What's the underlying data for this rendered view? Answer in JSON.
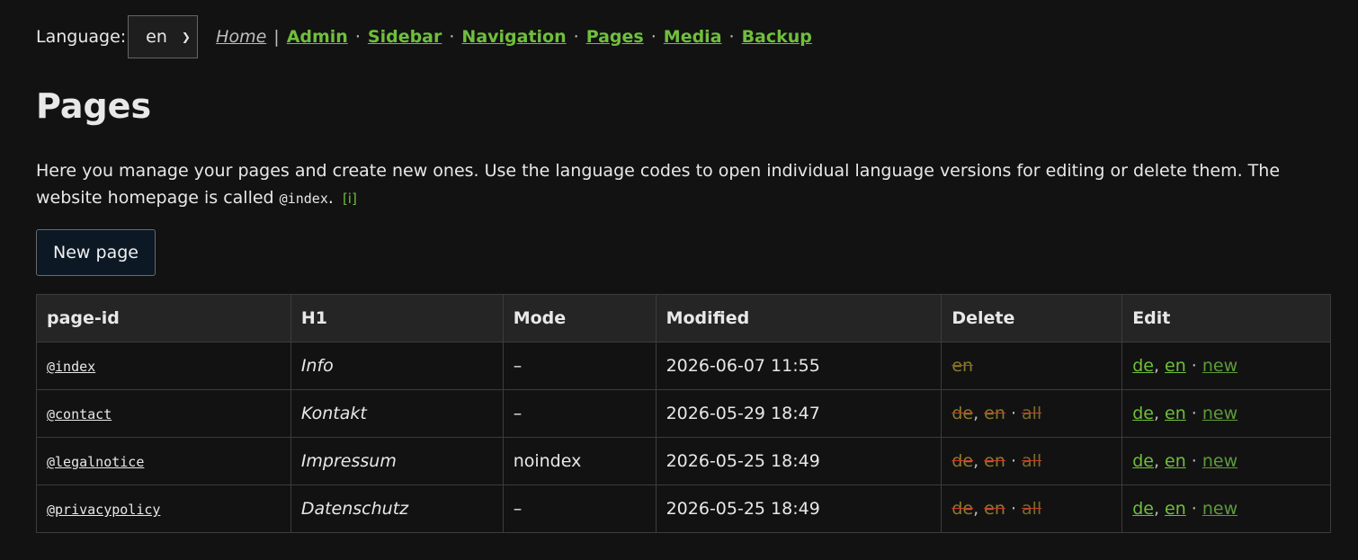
{
  "language": {
    "label": "Language:",
    "selected": "en"
  },
  "nav": {
    "home": "Home",
    "bar": "|",
    "dot": "·",
    "links": [
      "Admin",
      "Sidebar",
      "Navigation",
      "Pages",
      "Media",
      "Backup"
    ]
  },
  "page_title": "Pages",
  "intro": {
    "text": "Here you manage your pages and create new ones. Use the language codes to open individual language versions for editing or delete them. The website homepage is called",
    "code": "@index",
    "period": ".",
    "info": "[i]"
  },
  "new_page_button": "New page",
  "table": {
    "headers": [
      "page-id",
      "H1",
      "Mode",
      "Modified",
      "Delete",
      "Edit"
    ],
    "rows": [
      {
        "id": "@index",
        "h1": "Info",
        "mode": "–",
        "modified": "2026-06-07 11:55",
        "delete": [
          "en"
        ],
        "delete_all": "",
        "edit": [
          "de",
          "en"
        ],
        "edit_new": "new"
      },
      {
        "id": "@contact",
        "h1": "Kontakt",
        "mode": "–",
        "modified": "2026-05-29 18:47",
        "delete": [
          "de",
          "en"
        ],
        "delete_all": "all",
        "edit": [
          "de",
          "en"
        ],
        "edit_new": "new"
      },
      {
        "id": "@legalnotice",
        "h1": "Impressum",
        "mode": "noindex",
        "modified": "2026-05-25 18:49",
        "delete": [
          "de",
          "en"
        ],
        "delete_all": "all",
        "edit": [
          "de",
          "en"
        ],
        "edit_new": "new"
      },
      {
        "id": "@privacypolicy",
        "h1": "Datenschutz",
        "mode": "–",
        "modified": "2026-05-25 18:49",
        "delete": [
          "de",
          "en"
        ],
        "delete_all": "all",
        "edit": [
          "de",
          "en"
        ],
        "edit_new": "new"
      }
    ]
  },
  "colors": {
    "link": "#6fbf3c",
    "background": "#121212",
    "header_bg": "#252525"
  }
}
